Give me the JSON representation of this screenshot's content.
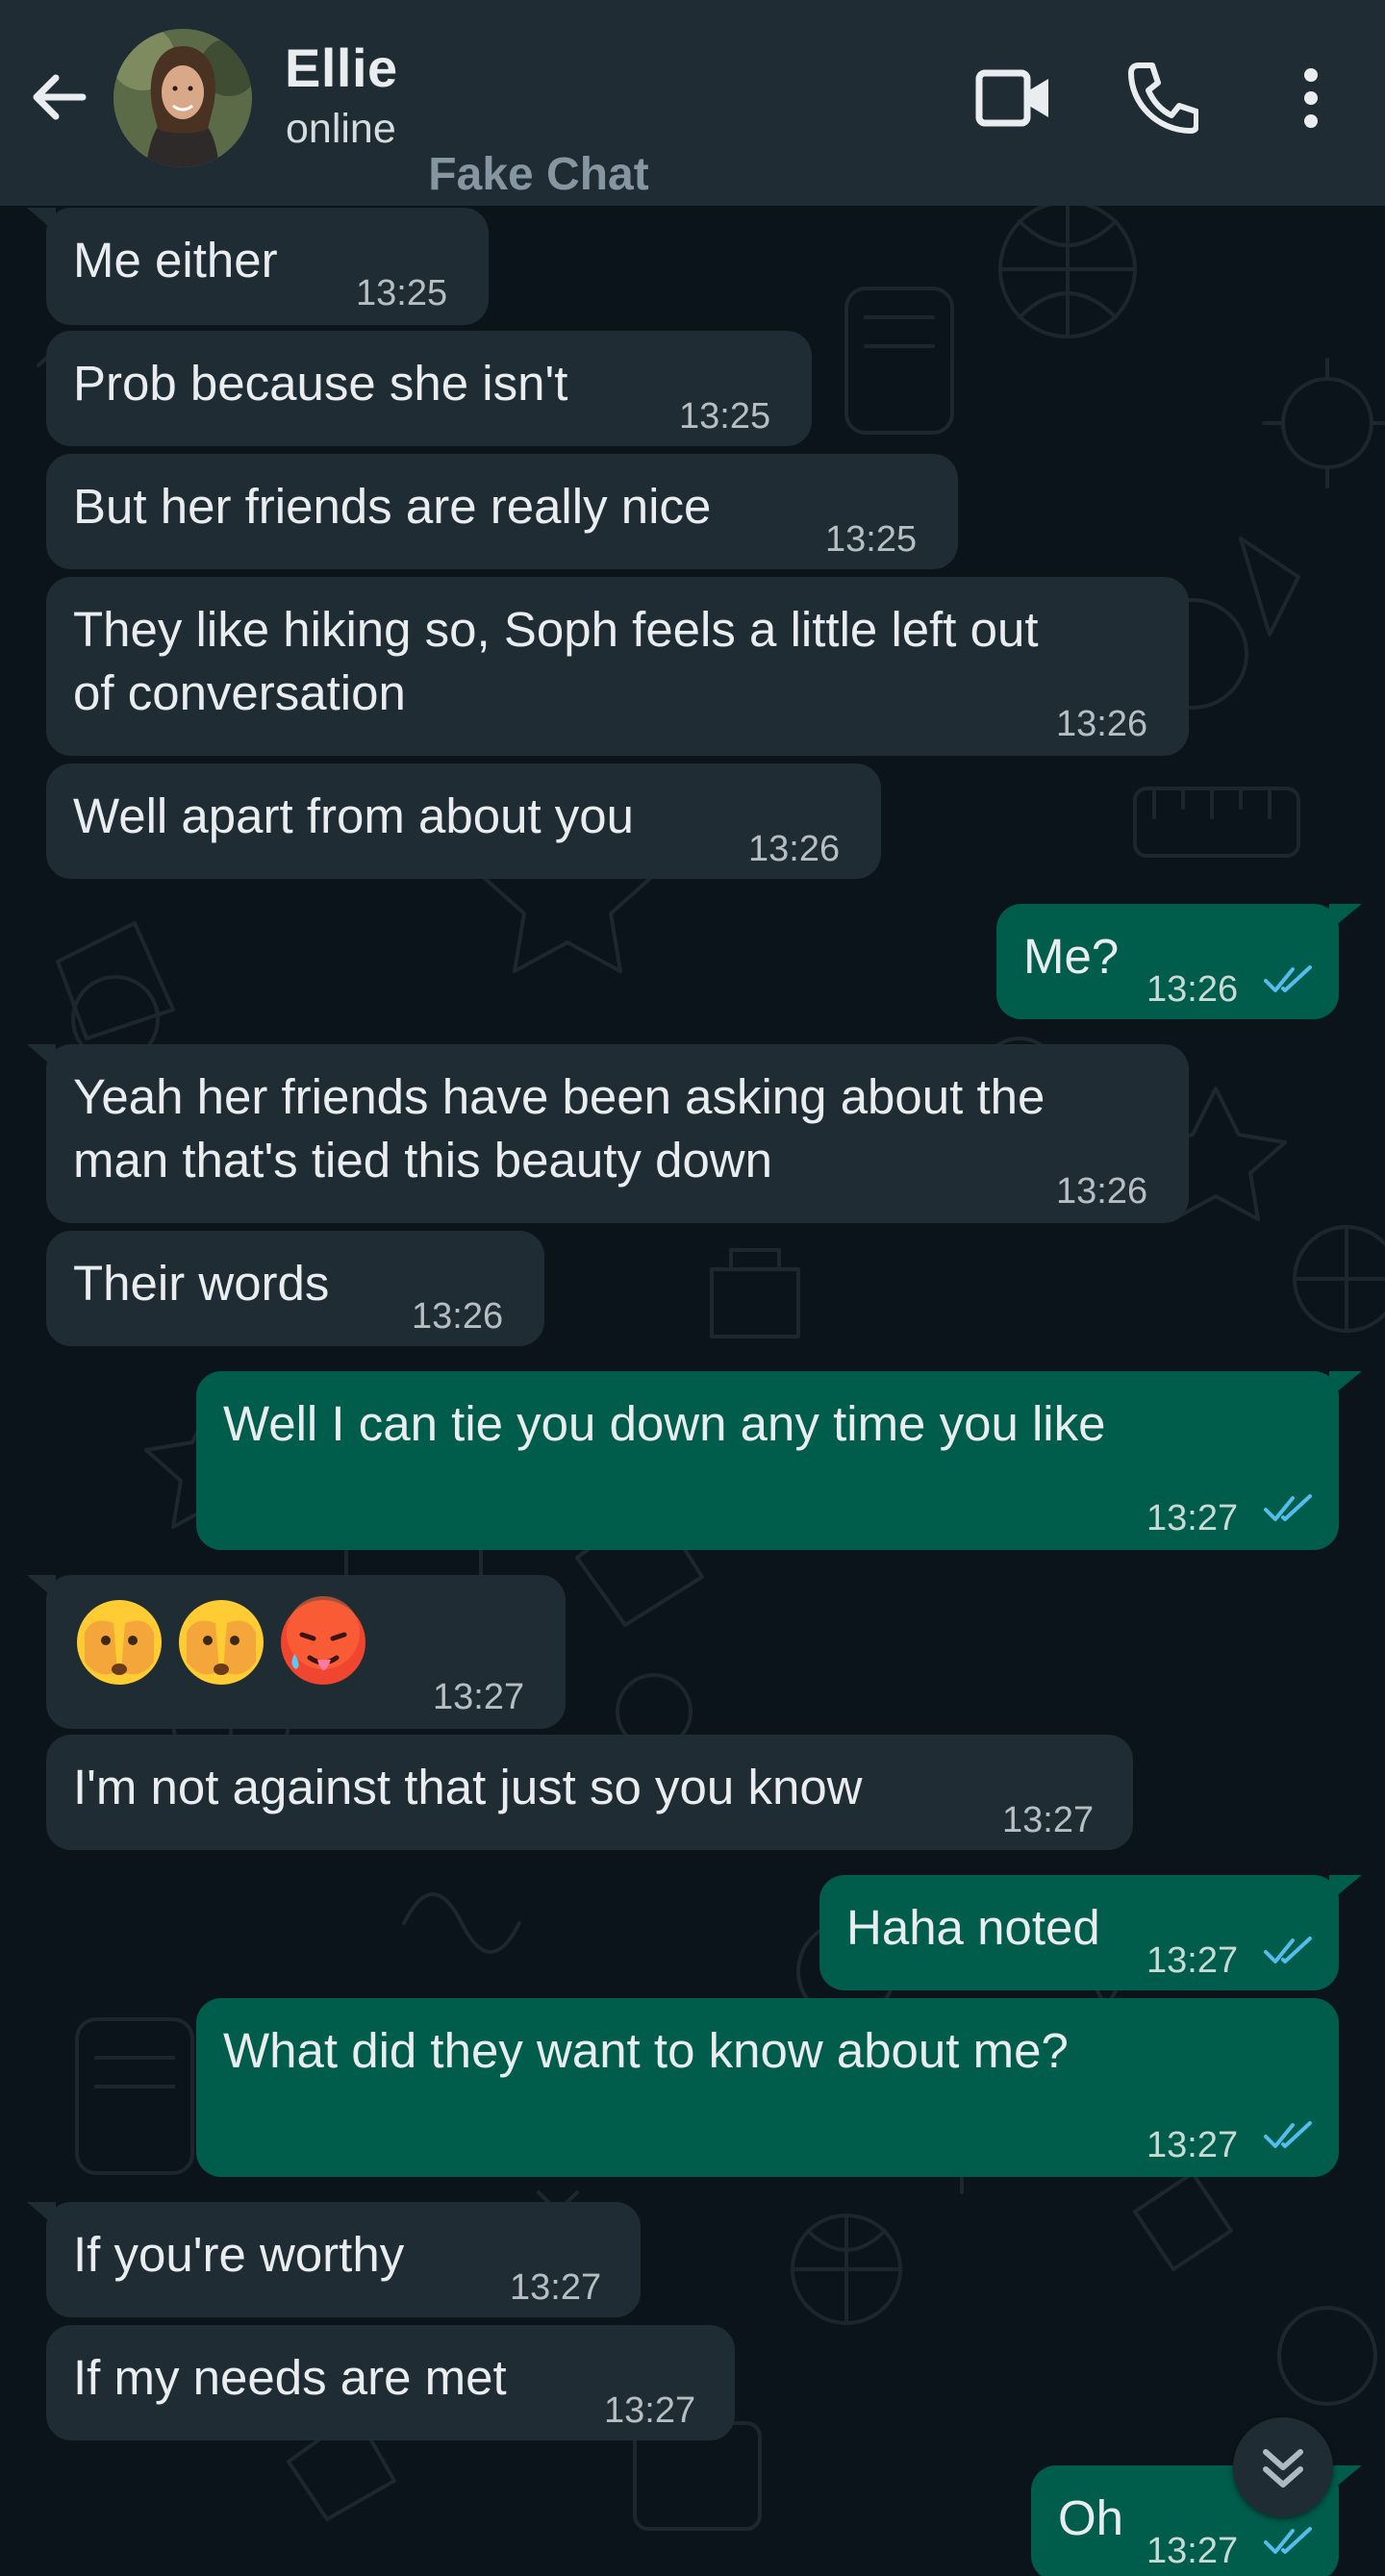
{
  "header": {
    "contact_name": "Ellie",
    "contact_status": "online",
    "watermark": "Fake Chat"
  },
  "icons": {
    "back": "arrow-left-icon",
    "video": "video-camera-icon",
    "call": "phone-icon",
    "menu": "more-vertical-icon",
    "scroll": "double-chevron-down-icon",
    "read": "double-check-icon"
  },
  "colors": {
    "header_bg": "#1f2c34",
    "chat_bg": "#0b141a",
    "incoming_bubble": "#202c33",
    "outgoing_bubble": "#005c4b",
    "read_ticks": "#53bdeb"
  },
  "messages": [
    {
      "dir": "in",
      "text": "Me either",
      "time": "13:25"
    },
    {
      "dir": "in",
      "text": "Prob because she isn't",
      "time": "13:25"
    },
    {
      "dir": "in",
      "text": "But her friends are really nice",
      "time": "13:25"
    },
    {
      "dir": "in",
      "text": "They like hiking so, Soph feels a little left out",
      "text2": "of conversation",
      "time": "13:26"
    },
    {
      "dir": "in",
      "text": "Well apart from about you",
      "time": "13:26"
    },
    {
      "dir": "out",
      "text": "Me?",
      "time": "13:26",
      "status": "read"
    },
    {
      "dir": "in",
      "text": "Yeah her friends have been asking about the",
      "text2": "man that's tied this beauty down",
      "time": "13:26"
    },
    {
      "dir": "in",
      "text": "Their words",
      "time": "13:26"
    },
    {
      "dir": "out",
      "text": "Well I can tie you down any time you like",
      "time": "13:27",
      "status": "read"
    },
    {
      "dir": "in",
      "emojis": [
        "face-with-peeking-eye",
        "face-with-peeking-eye",
        "hot-face"
      ],
      "time": "13:27"
    },
    {
      "dir": "in",
      "text": "I'm not against that just so you know",
      "time": "13:27"
    },
    {
      "dir": "out",
      "text": "Haha noted",
      "time": "13:27",
      "status": "read"
    },
    {
      "dir": "out",
      "text": "What did they want to know about me?",
      "time": "13:27",
      "status": "read"
    },
    {
      "dir": "in",
      "text": "If you're worthy",
      "time": "13:27"
    },
    {
      "dir": "in",
      "text": "If my needs are met",
      "time": "13:27"
    },
    {
      "dir": "out",
      "text": "Oh",
      "time": "13:27",
      "status": "read"
    }
  ]
}
